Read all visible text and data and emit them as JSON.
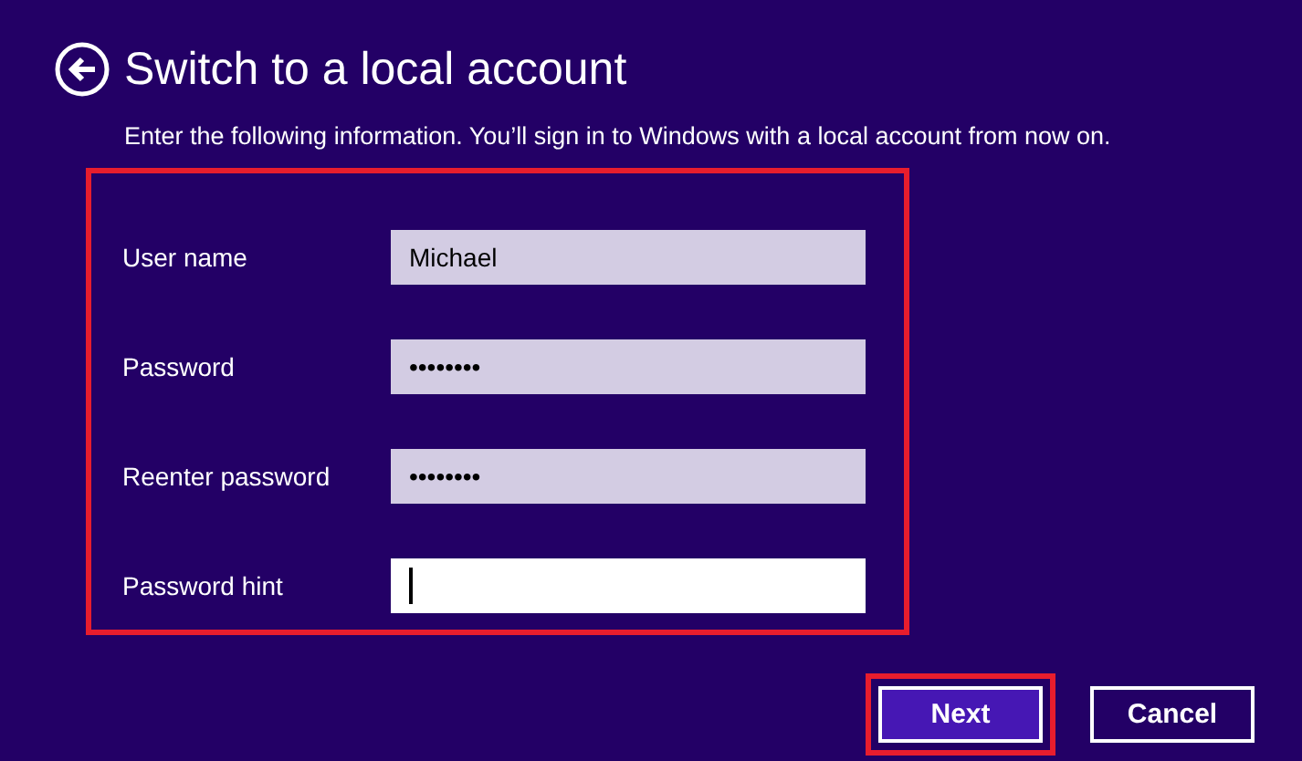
{
  "header": {
    "title": "Switch to a local account",
    "subtitle": "Enter the following information. You’ll sign in to Windows with a local account from now on."
  },
  "form": {
    "highlighted": true,
    "fields": [
      {
        "label": "User name",
        "value": "Michael",
        "focused": false
      },
      {
        "label": "Password",
        "value": "••••••••",
        "focused": false
      },
      {
        "label": "Reenter password",
        "value": "••••••••",
        "focused": false
      },
      {
        "label": "Password hint",
        "focused": true
      }
    ]
  },
  "buttons": [
    {
      "label": "Next",
      "kind": "primary",
      "highlighted": true
    },
    {
      "label": "Cancel",
      "kind": "secondary",
      "highlighted": false
    }
  ]
}
